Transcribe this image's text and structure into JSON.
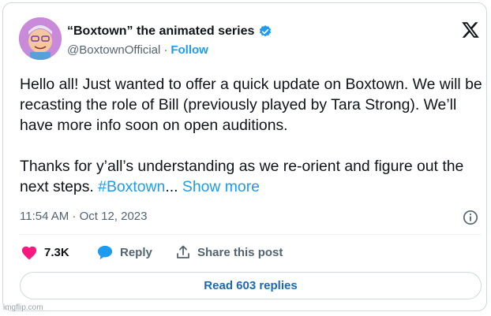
{
  "author": {
    "display_name": "“Boxtown” the animated series",
    "handle": "@BoxtownOfficial",
    "separator": "·",
    "follow_label": "Follow"
  },
  "tweet": {
    "paragraph_1": "Hello all! Just wanted to offer a quick update on Boxtown. We will be recasting the role of Bill (previously played by Tara Strong). We’ll have more info soon on open auditions.",
    "paragraph_2_text": "Thanks for y’all’s understanding as we re-orient and figure out the next steps. ",
    "hashtag": "#Boxtown",
    "ellipsis": "...",
    "show_more": " Show more",
    "timestamp": "11:54 AM · Oct 12, 2023"
  },
  "actions": {
    "like_count": "7.3K",
    "reply_label": "Reply",
    "share_label": "Share this post"
  },
  "read_replies_label": "Read 603 replies",
  "watermark": "imgflip.com",
  "colors": {
    "accent": "#1d9bf0",
    "like_pink": "#f91880",
    "text": "#0f1419",
    "muted": "#536471"
  },
  "icons": [
    "verified-badge-icon",
    "x-logo-icon",
    "info-icon",
    "heart-icon",
    "reply-bubble-icon",
    "share-icon"
  ]
}
